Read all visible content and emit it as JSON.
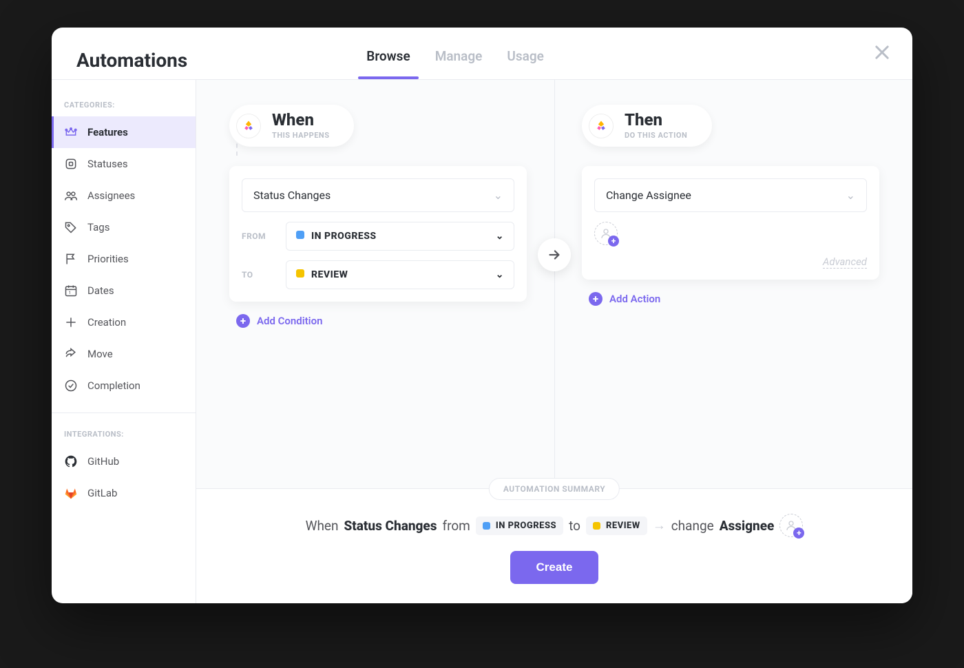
{
  "header": {
    "title": "Automations"
  },
  "tabs": {
    "browse": "Browse",
    "manage": "Manage",
    "usage": "Usage"
  },
  "sidebar": {
    "categories_label": "CATEGORIES:",
    "integrations_label": "INTEGRATIONS:",
    "items": {
      "features": "Features",
      "statuses": "Statuses",
      "assignees": "Assignees",
      "tags": "Tags",
      "priorities": "Priorities",
      "dates": "Dates",
      "creation": "Creation",
      "move": "Move",
      "completion": "Completion",
      "github": "GitHub",
      "gitlab": "GitLab"
    }
  },
  "when": {
    "title": "When",
    "sub": "THIS HAPPENS",
    "trigger": "Status Changes",
    "from_label": "FROM",
    "to_label": "TO",
    "status_from": "IN PROGRESS",
    "status_to": "REVIEW",
    "add_label": "Add Condition"
  },
  "then": {
    "title": "Then",
    "sub": "DO THIS ACTION",
    "action": "Change Assignee",
    "advanced": "Advanced",
    "add_label": "Add Action"
  },
  "summary": {
    "badge": "AUTOMATION SUMMARY",
    "when": "When",
    "trigger": "Status Changes",
    "from_word": "from",
    "status_from": "IN PROGRESS",
    "to_word": "to",
    "status_to": "REVIEW",
    "change_word": "change",
    "target": "Assignee",
    "create": "Create"
  },
  "colors": {
    "in_progress": "#4f9ff6",
    "review": "#f5c400",
    "accent": "#7b68ee"
  }
}
